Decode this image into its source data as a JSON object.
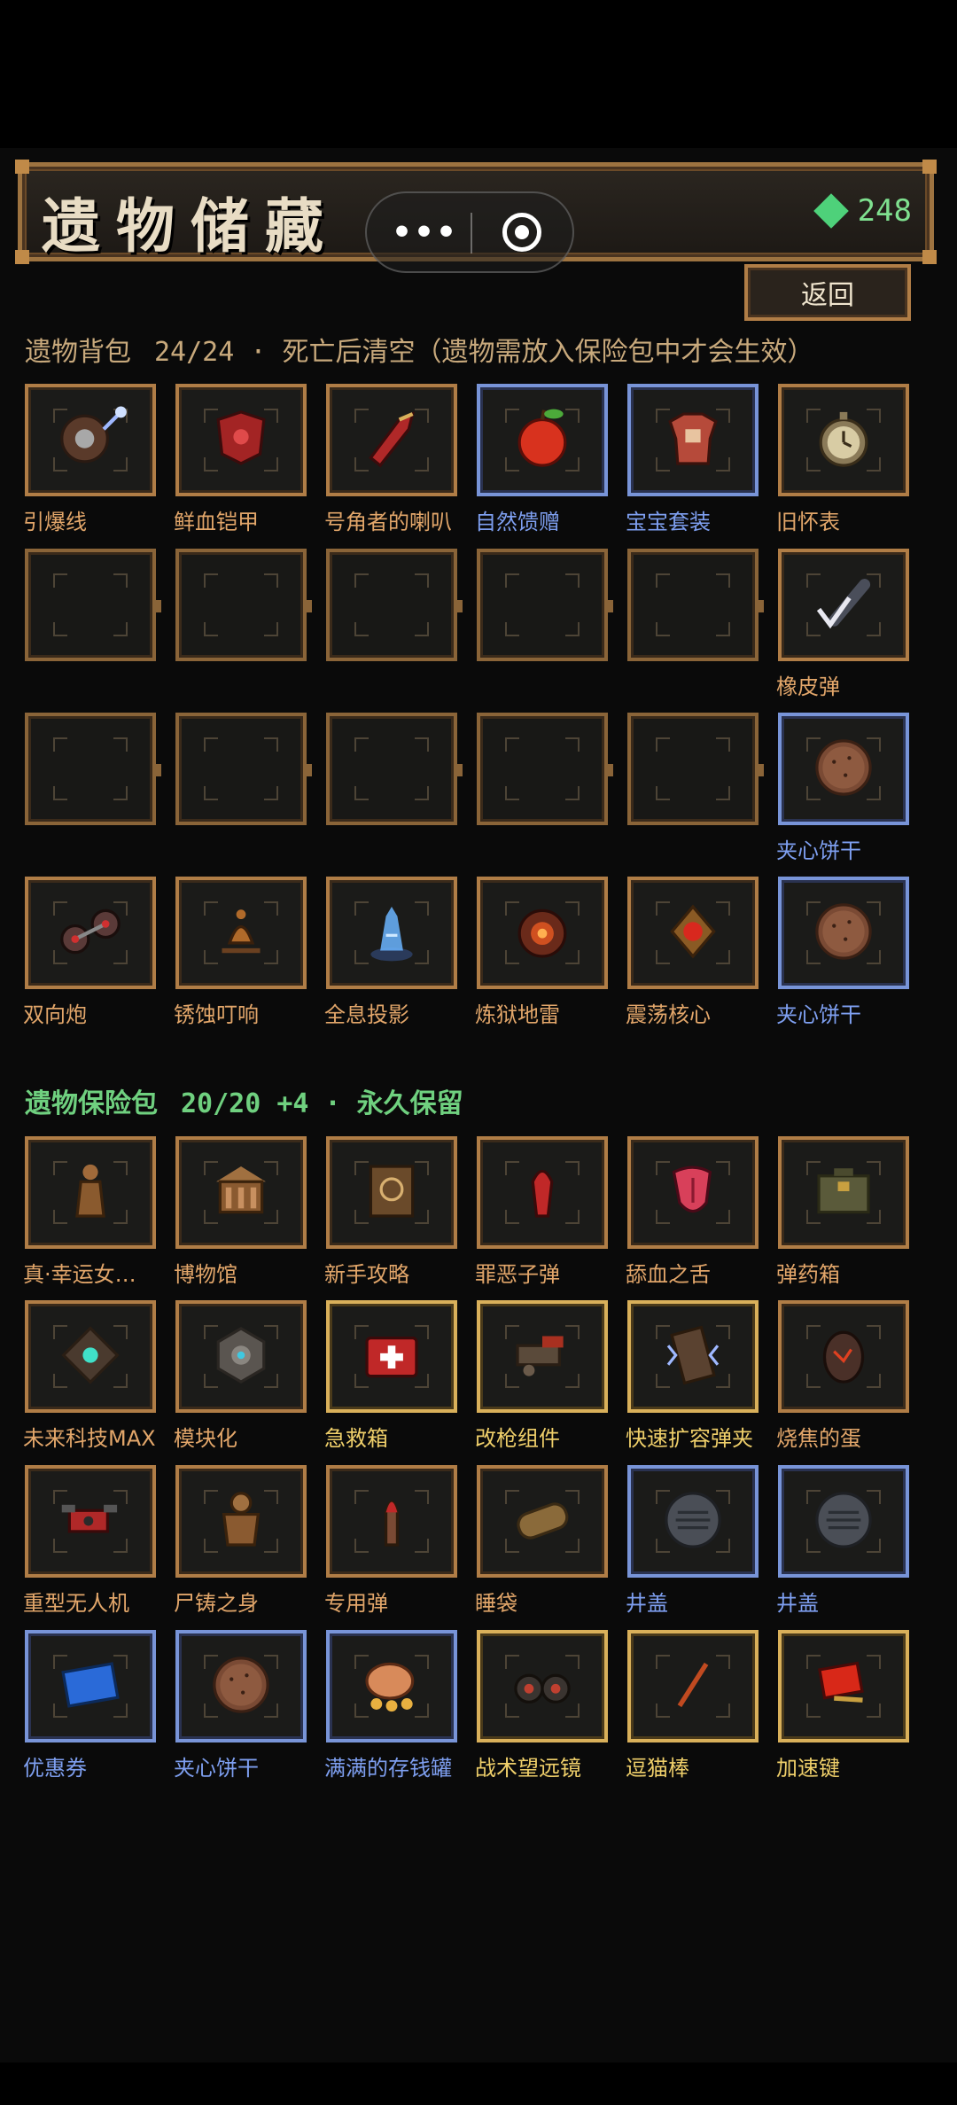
{
  "header": {
    "title": "遗物储藏",
    "currency": "248",
    "currency_icon": "green-gem-icon",
    "back_label": "返回"
  },
  "colors": {
    "frame_orange": "#b07d46",
    "frame_blue": "#7894d8",
    "frame_gold": "#d9b05a",
    "label_orange": "#e2a66a",
    "label_blue": "#7e9ff0",
    "label_gold": "#efcf6a",
    "safe_green": "#6fd07f"
  },
  "backpack": {
    "title": "遗物背包",
    "meta": "24/24 · 死亡后清空（遗物需放入保险包中才会生效）",
    "rows": [
      [
        {
          "name": "引爆线",
          "rarity": "orange",
          "icon": "fuse-coil-icon"
        },
        {
          "name": "鲜血铠甲",
          "rarity": "orange",
          "icon": "blood-armor-icon"
        },
        {
          "name": "号角者的喇叭",
          "rarity": "orange",
          "icon": "horn-icon"
        },
        {
          "name": "自然馈赠",
          "rarity": "blue",
          "icon": "apple-icon"
        },
        {
          "name": "宝宝套装",
          "rarity": "blue",
          "icon": "baby-suit-icon"
        },
        {
          "name": "旧怀表",
          "rarity": "orange",
          "icon": "pocket-watch-icon"
        }
      ],
      [
        null,
        null,
        null,
        null,
        null,
        {
          "name": "橡皮弹",
          "rarity": "orange",
          "icon": "rubber-bullet-icon"
        }
      ],
      [
        null,
        null,
        null,
        null,
        null,
        {
          "name": "夹心饼干",
          "rarity": "blue",
          "icon": "cookie-icon"
        }
      ],
      [
        {
          "name": "双向炮",
          "rarity": "orange",
          "icon": "twin-cannon-icon"
        },
        {
          "name": "锈蚀叮响",
          "rarity": "orange",
          "icon": "rusty-bell-icon"
        },
        {
          "name": "全息投影",
          "rarity": "orange",
          "icon": "hologram-icon"
        },
        {
          "name": "炼狱地雷",
          "rarity": "orange",
          "icon": "landmine-icon"
        },
        {
          "name": "震荡核心",
          "rarity": "orange",
          "icon": "shock-core-icon"
        },
        {
          "name": "夹心饼干",
          "rarity": "blue",
          "icon": "cookie-icon"
        }
      ]
    ]
  },
  "safe": {
    "title": "遗物保险包",
    "meta": "20/20 +4 · 永久保留",
    "rows": [
      [
        {
          "name": "真·幸运女…",
          "rarity": "orange",
          "icon": "statue-icon"
        },
        {
          "name": "博物馆",
          "rarity": "orange",
          "icon": "museum-icon"
        },
        {
          "name": "新手攻略",
          "rarity": "orange",
          "icon": "guide-book-icon"
        },
        {
          "name": "罪恶子弹",
          "rarity": "orange",
          "icon": "sin-bullet-icon"
        },
        {
          "name": "舔血之舌",
          "rarity": "orange",
          "icon": "tongue-icon"
        },
        {
          "name": "弹药箱",
          "rarity": "orange",
          "icon": "ammo-box-icon"
        }
      ],
      [
        {
          "name": "未来科技MAX",
          "rarity": "orange",
          "icon": "tech-core-icon"
        },
        {
          "name": "模块化",
          "rarity": "orange",
          "icon": "module-icon"
        },
        {
          "name": "急救箱",
          "rarity": "gold",
          "icon": "first-aid-icon"
        },
        {
          "name": "改枪组件",
          "rarity": "gold",
          "icon": "gun-parts-icon"
        },
        {
          "name": "快速扩容弹夹",
          "rarity": "gold",
          "icon": "magazine-icon"
        },
        {
          "name": "烧焦的蛋",
          "rarity": "orange",
          "icon": "burnt-egg-icon"
        }
      ],
      [
        {
          "name": "重型无人机",
          "rarity": "orange",
          "icon": "drone-icon"
        },
        {
          "name": "尸铸之身",
          "rarity": "orange",
          "icon": "golem-icon"
        },
        {
          "name": "专用弹",
          "rarity": "orange",
          "icon": "bullet-icon"
        },
        {
          "name": "睡袋",
          "rarity": "orange",
          "icon": "sleeping-bag-icon"
        },
        {
          "name": "井盖",
          "rarity": "blue",
          "icon": "manhole-icon"
        },
        {
          "name": "井盖",
          "rarity": "blue",
          "icon": "manhole-icon"
        }
      ],
      [
        {
          "name": "优惠券",
          "rarity": "blue",
          "icon": "coupon-icon"
        },
        {
          "name": "夹心饼干",
          "rarity": "blue",
          "icon": "cookie-icon"
        },
        {
          "name": "满满的存钱罐",
          "rarity": "blue",
          "icon": "piggy-bank-icon"
        },
        {
          "name": "战术望远镜",
          "rarity": "gold",
          "icon": "binoculars-icon"
        },
        {
          "name": "逗猫棒",
          "rarity": "gold",
          "icon": "cat-wand-icon"
        },
        {
          "name": "加速键",
          "rarity": "gold",
          "icon": "speed-key-icon"
        }
      ]
    ]
  }
}
